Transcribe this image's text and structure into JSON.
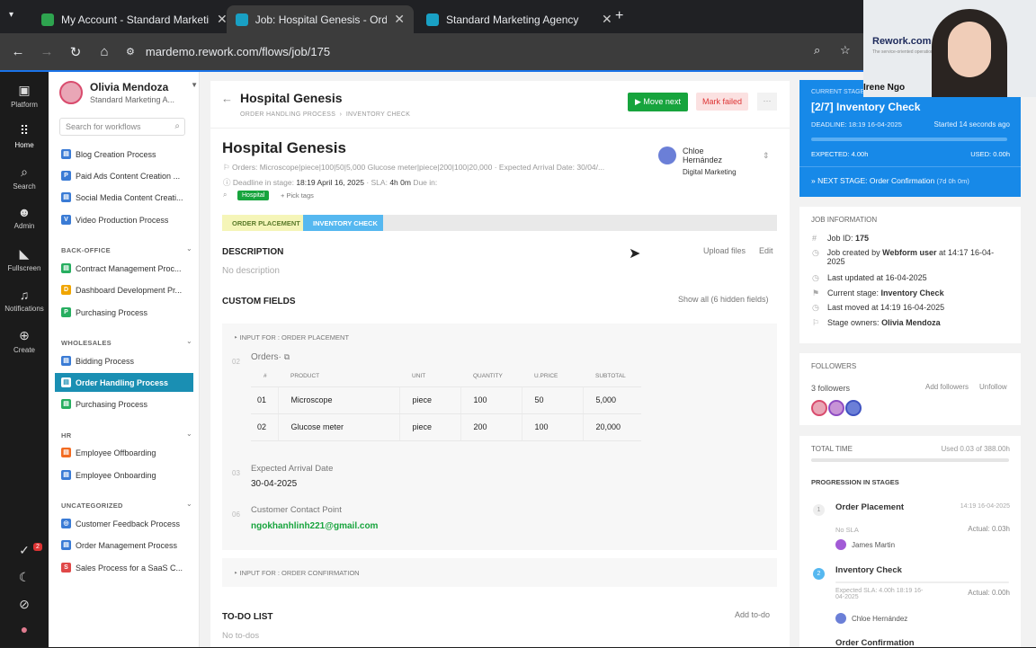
{
  "tabs": [
    {
      "label": "My Account - Standard Marketing",
      "color": "#2ea44f"
    },
    {
      "label": "Job: Hospital Genesis - Order Handling",
      "color": "#19a0c4"
    },
    {
      "label": "Standard Marketing Agency",
      "color": "#19a0c4"
    }
  ],
  "url": "mardemo.rework.com/flows/job/175",
  "rail": [
    "Platform",
    "Home",
    "Search",
    "Admin",
    "Fullscreen",
    "Notifications",
    "Create"
  ],
  "rail_badge": "2",
  "user": {
    "name": "Olivia Mendoza",
    "org": "Standard Marketing A..."
  },
  "search_placeholder": "Search for workflows",
  "groups": {
    "backoffice": "BACK-OFFICE",
    "wholesales": "WHOLESALES",
    "hr": "HR",
    "uncat": "UNCATEGORIZED"
  },
  "items": {
    "blog": "Blog Creation Process",
    "paid": "Paid Ads Content Creation ...",
    "social": "Social Media Content Creati...",
    "video": "Video Production Process",
    "contract": "Contract Management Proc...",
    "dashboard": "Dashboard Development Pr...",
    "purch1": "Purchasing Process",
    "bidding": "Bidding Process",
    "order": "Order Handling Process",
    "purch2": "Purchasing Process",
    "offb": "Employee Offboarding",
    "onb": "Employee Onboarding",
    "cfb": "Customer Feedback Process",
    "omp": "Order Management Process",
    "sales": "Sales Process for a SaaS C..."
  },
  "job": {
    "title": "Hospital Genesis",
    "bc1": "ORDER HANDLING PROCESS",
    "bc2": "INVENTORY CHECK",
    "move_next": "Move next",
    "mark_failed": "Mark failed",
    "heading": "Hospital Genesis",
    "summary": "Orders: Microscope|piece|100|50|5,000 Glucose meter|piece|200|100|20,000 · Expected Arrival Date: 30/04/...",
    "deadline_label": "Deadline in stage:",
    "deadline": "18:19 April 16, 2025",
    "sla_label": "· SLA:",
    "sla": "4h 0m",
    "due": "Due in:",
    "tag": "Hospital",
    "pick_tags": "+ Pick tags",
    "assignee_first": "Chloe",
    "assignee_last": "Hernández",
    "assignee_team": "Digital Marketing"
  },
  "stages": [
    "ORDER PLACEMENT",
    "INVENTORY CHECK"
  ],
  "description": {
    "title": "DESCRIPTION",
    "empty": "No description",
    "upload": "Upload files",
    "edit": "Edit"
  },
  "custom": {
    "title": "CUSTOM FIELDS",
    "show_all": "Show all (6 hidden fields)",
    "input_for": "INPUT FOR : ORDER PLACEMENT",
    "input_for2": "INPUT FOR : ORDER CONFIRMATION",
    "n02": "02",
    "orders_label": "Orders·",
    "n03": "03",
    "arrival_label": "Expected Arrival Date",
    "arrival": "30-04-2025",
    "n06": "06",
    "contact_label": "Customer Contact Point",
    "contact": "ngokhanhlinh221@gmail.com"
  },
  "table": {
    "headers": [
      "#",
      "PRODUCT",
      "UNIT",
      "QUANTITY",
      "U.PRICE",
      "SUBTOTAL"
    ],
    "rows": [
      [
        "01",
        "Microscope",
        "piece",
        "100",
        "50",
        "5,000"
      ],
      [
        "02",
        "Glucose meter",
        "piece",
        "200",
        "100",
        "20,000"
      ]
    ]
  },
  "todo": {
    "title": "TO-DO LIST",
    "add": "Add to-do",
    "empty": "No to-dos"
  },
  "current": {
    "label": "CURRENT STAGE",
    "title": "[2/7] Inventory Check",
    "deadline": "DEADLINE: 18:19 16-04-2025",
    "started": "Started 14 seconds ago",
    "expected": "EXPECTED: 4.00h",
    "used": "USED: 0.00h",
    "next_label": "» NEXT STAGE:",
    "next": "Order Confirmation",
    "next_time": "(7d 0h 0m)"
  },
  "jobinfo": {
    "title": "JOB INFORMATION",
    "id_label": "Job ID:",
    "id": "175",
    "created_pre": "Job created by",
    "created_by": "Webform user",
    "created_at": "at 14:17 16-04-2025",
    "updated": "Last updated at 16-04-2025",
    "stage_label": "Current stage:",
    "stage": "Inventory Check",
    "moved": "Last moved at 14:19 16-04-2025",
    "owners_label": "Stage owners:",
    "owners": "Olivia Mendoza"
  },
  "followers": {
    "title": "FOLLOWERS",
    "count": "3 followers",
    "add": "Add followers",
    "unfollow": "Unfollow"
  },
  "total": {
    "title": "TOTAL TIME",
    "used": "Used 0.03 of 388.00h",
    "prog": "PROGRESSION IN STAGES",
    "s1": "Order Placement",
    "s1_time": "14:19 16-04-2025",
    "s1_sla": "No SLA",
    "s1_actual": "Actual: 0.03h",
    "s1_user": "James Martin",
    "s2": "Inventory Check",
    "s2_sla": "Expected SLA: 4.00h",
    "s2_time": "18:19 16-04-2025",
    "s2_actual": "Actual: 0.00h",
    "s2_user": "Chloe Hernández",
    "s3": "Order Confirmation",
    "n1": "1",
    "n2": "2"
  },
  "webcam": {
    "brand": "Rework.com",
    "tagline": "The service-oriented operation platform",
    "name": "Irene Ngo"
  }
}
